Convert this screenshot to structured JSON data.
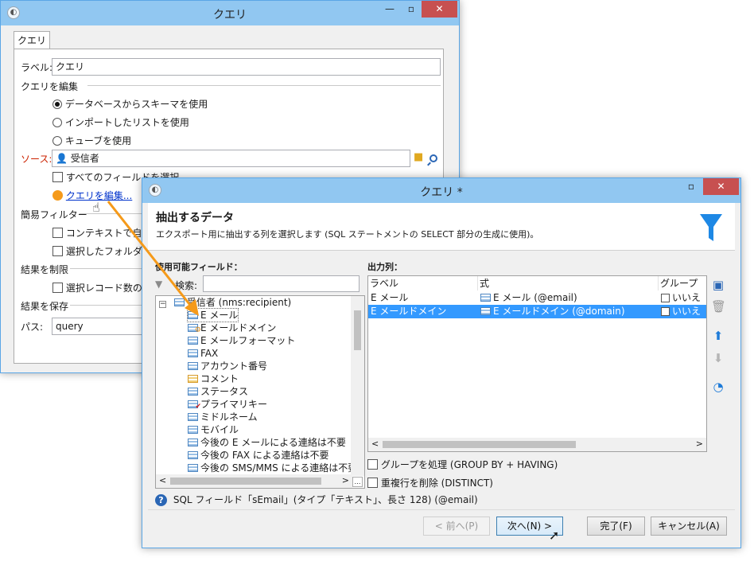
{
  "back_window": {
    "title": "クエリ",
    "tab": "クエリ",
    "label_caption": "ラベル:",
    "label_value": "クエリ",
    "edit_section": "クエリを編集",
    "radio_options": [
      "データベースからスキーマを使用",
      "インポートしたリストを使用",
      "キューブを使用"
    ],
    "source_caption": "ソース:",
    "source_value": "受信者",
    "all_fields_check": "すべてのフィールドを選択",
    "edit_link": "クエリを編集...",
    "simple_filter_section": "簡易フィルター",
    "context_check": "コンテキストで自動的",
    "folder_check": "選択したフォルダーに",
    "limit_section": "結果を制限",
    "limit_check": "選択レコード数の制限",
    "save_section": "結果を保存",
    "path_caption": "パス:",
    "path_value": "query"
  },
  "front_window": {
    "title": "クエリ *",
    "header_title": "抽出するデータ",
    "header_desc": "エクスポート用に抽出する列を選択します (SQL ステートメントの SELECT 部分の生成に使用)。",
    "available_caption": "使用可能フィールド：",
    "search_caption": "検索:",
    "search_value": "",
    "tree_root": "受信者 (nms:recipient)",
    "tree_items": [
      "E メール",
      "E メールドメイン",
      "E メールフォーマット",
      "FAX",
      "アカウント番号",
      "コメント",
      "ステータス",
      "プライマリキー",
      "ミドルネーム",
      "モバイル",
      "今後の E メールによる連絡は不要",
      "今後の FAX による連絡は不要",
      "今後の SMS/MMS による連絡は不要"
    ],
    "output_caption": "出力列：",
    "output_headers": [
      "ラベル",
      "式",
      "グループ"
    ],
    "output_rows": [
      {
        "label": "E メール",
        "expr": "E メール (@email)",
        "group": "いいえ"
      },
      {
        "label": "E メールドメイン",
        "expr": "E メールドメイン (@domain)",
        "group": "いいえ"
      }
    ],
    "group_by_check": "グループを処理 (GROUP BY + HAVING)",
    "distinct_check": "重複行を削除 (DISTINCT)",
    "status_text": "SQL フィールド「sEmail」(タイプ「テキスト」、長さ 128) (@email)",
    "buttons": {
      "back": "< 前へ(P)",
      "next": "次へ(N) >",
      "finish": "完了(F)",
      "cancel": "キャンセル(A)"
    }
  },
  "colors": {
    "titlebar": "#91c7f1",
    "selection": "#3399ff",
    "close": "#c75050",
    "accent_orange": "#f59a1a",
    "funnel": "#1e88e5"
  }
}
